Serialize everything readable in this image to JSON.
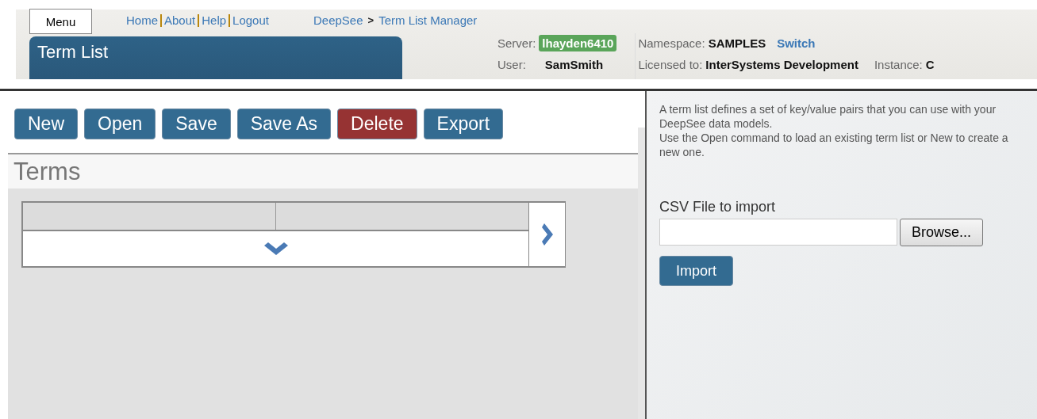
{
  "header": {
    "menu_button": "Menu",
    "links": [
      "Home",
      "About",
      "Help",
      "Logout"
    ],
    "breadcrumb": [
      "DeepSee",
      ">",
      "Term List Manager"
    ],
    "page_title": "Term List",
    "server": {
      "label": "Server:",
      "value": "lhayden6410"
    },
    "user": {
      "label": "User:",
      "value": "SamSmith"
    },
    "namespace": {
      "label": "Namespace:",
      "value": "SAMPLES",
      "action": "Switch"
    },
    "licensed": {
      "label": "Licensed to:",
      "value": "InterSystems Development"
    },
    "instance": {
      "label": "Instance:",
      "value": "C"
    }
  },
  "toolbar": [
    {
      "label": "New",
      "kind": "primary"
    },
    {
      "label": "Open",
      "kind": "primary"
    },
    {
      "label": "Save",
      "kind": "primary"
    },
    {
      "label": "Save As",
      "kind": "primary"
    },
    {
      "label": "Delete",
      "kind": "danger"
    },
    {
      "label": "Export",
      "kind": "primary"
    }
  ],
  "terms": {
    "heading": "Terms"
  },
  "help": {
    "lines": [
      "A term list defines a set of key/value pairs that you can use with your DeepSee data models.",
      "Use the Open command to load an existing term list or New to create a new one."
    ]
  },
  "import": {
    "label": "CSV File to import",
    "browse": "Browse...",
    "button": "Import"
  }
}
